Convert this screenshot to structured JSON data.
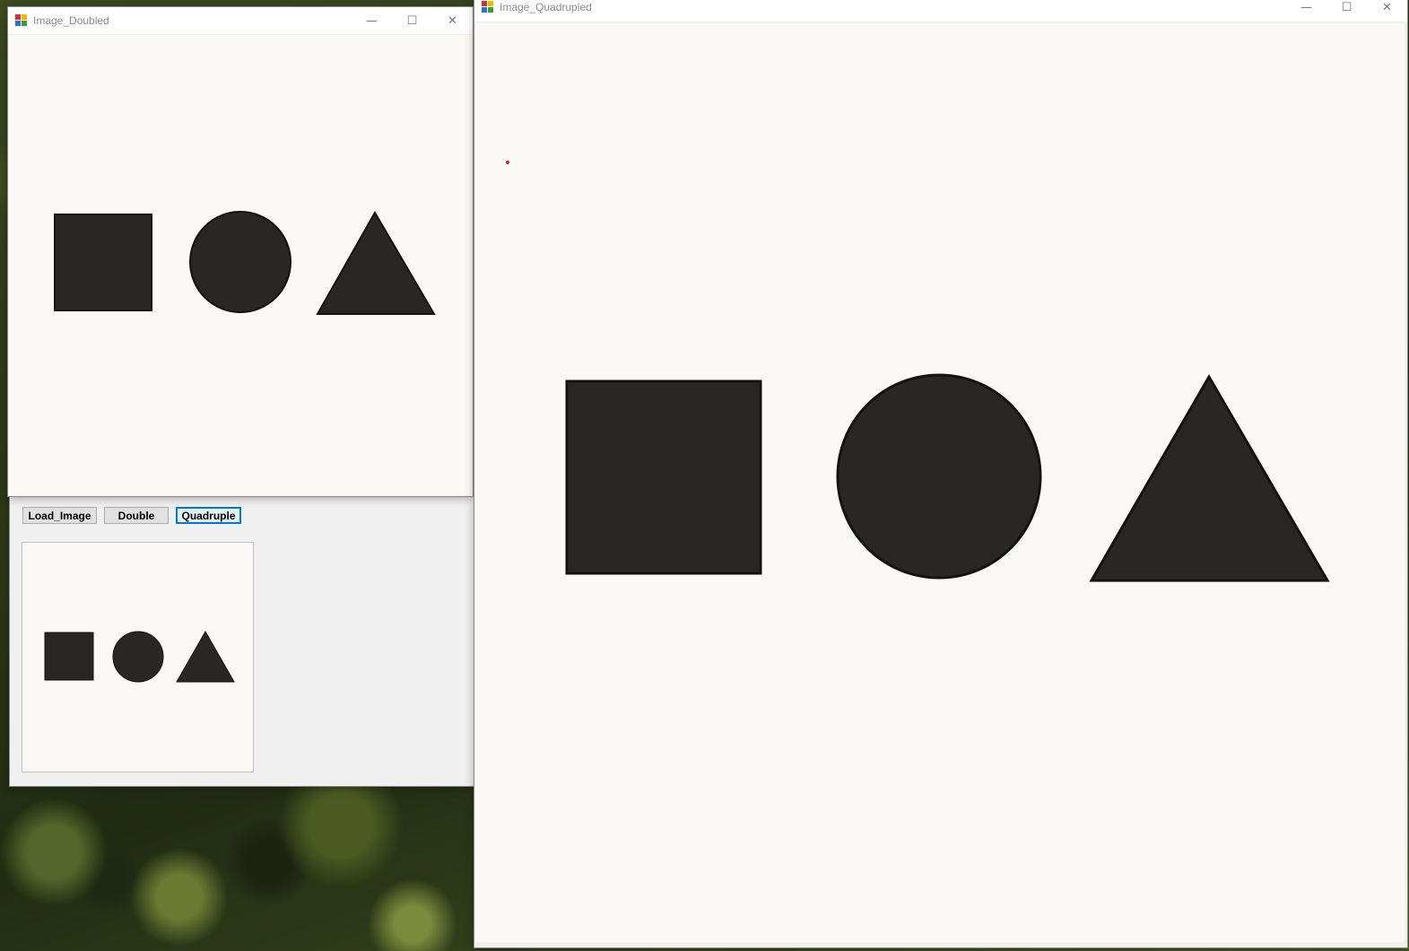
{
  "windows": {
    "doubled": {
      "title": "Image_Doubled",
      "controls": {
        "minimize": "—",
        "maximize": "☐",
        "close": "✕"
      }
    },
    "main": {
      "buttons": {
        "load": "Load_Image",
        "double": "Double",
        "quadruple": "Quadruple"
      }
    },
    "quadrupled": {
      "title": "Image_Quadrupled",
      "controls": {
        "minimize": "—",
        "maximize": "☐",
        "close": "✕"
      }
    }
  },
  "image": {
    "shapes": [
      "square",
      "circle",
      "triangle"
    ],
    "shape_color": "#2a2623",
    "background_color": "#faf9f5"
  },
  "colors": {
    "focus_border": "#0078d7",
    "button_face": "#e1e1e1",
    "window_face": "#f0f0f0"
  },
  "icons": [
    "app-icon",
    "minimize-icon",
    "maximize-icon",
    "close-icon"
  ]
}
